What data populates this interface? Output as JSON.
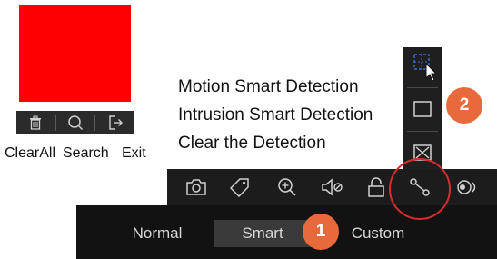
{
  "swatch": {
    "color": "#ff0000"
  },
  "mini_toolbar": {
    "icons": [
      "trash-icon",
      "search-icon",
      "exit-icon"
    ],
    "labels": {
      "clear_all": "ClearAll",
      "search": "Search",
      "exit": "Exit"
    }
  },
  "detection_list": {
    "items": [
      "Motion Smart Detection",
      "Intrusion Smart Detection",
      "Clear the Detection"
    ]
  },
  "vertical_toolbar": {
    "icons": [
      "motion-grid-icon",
      "rectangle-icon",
      "clear-box-icon"
    ]
  },
  "markers": {
    "one": "1",
    "two": "2",
    "color": "#e86a3c"
  },
  "main_toolbar": {
    "icons": [
      "camera-icon",
      "tag-icon",
      "zoom-in-icon",
      "audio-mute-icon",
      "lock-icon",
      "smart-detection-icon",
      "eye-icon"
    ]
  },
  "mode_tabs": {
    "normal": "Normal",
    "smart": "Smart",
    "custom": "Custom",
    "selected": "Smart"
  },
  "highlight": {
    "color": "#d62c2c"
  }
}
